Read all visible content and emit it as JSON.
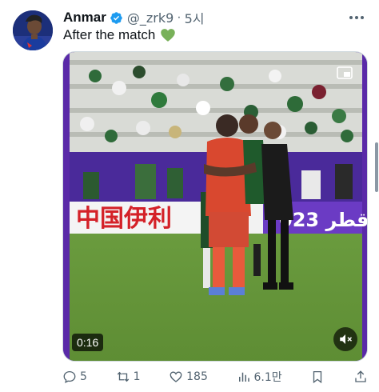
{
  "author": {
    "name": "Anmar",
    "handle": "@_zrk9",
    "separator": "·",
    "time": "5시",
    "verified": true,
    "avatar_icon": "profile-photo"
  },
  "tweet": {
    "text": "After the match",
    "emoji_icon": "green-heart-icon"
  },
  "media": {
    "type": "video",
    "duration": "0:16",
    "banner_text_left": "中国伊利",
    "banner_text_right": "023 قطر",
    "mute_icon": "speaker-muted-icon",
    "pip_icon": "picture-in-picture-icon"
  },
  "actions": {
    "replies": "5",
    "reposts": "1",
    "likes": "185",
    "views": "6.1만"
  },
  "colors": {
    "text": "#0f1419",
    "secondary": "#536471",
    "verified": "#1d9bf0",
    "green_heart": "#78b159",
    "media_border": "#5a2aa8"
  }
}
